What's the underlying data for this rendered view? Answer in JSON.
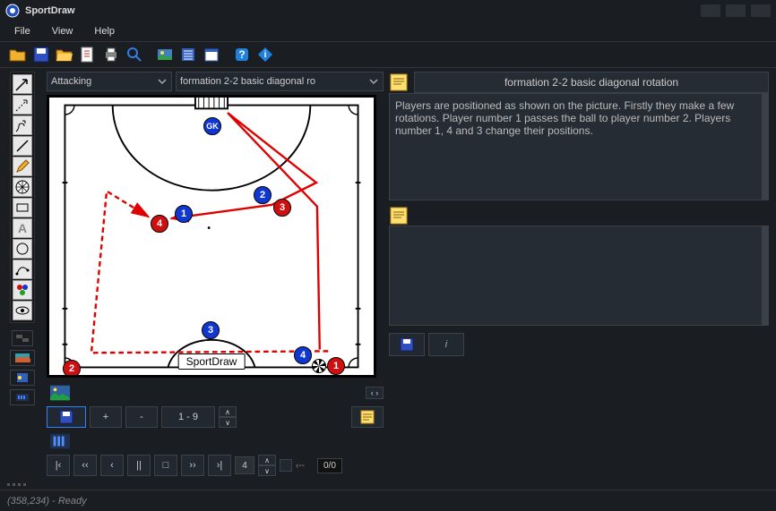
{
  "app": {
    "title": "SportDraw"
  },
  "menu": {
    "file": "File",
    "view": "View",
    "help": "Help"
  },
  "dropdowns": {
    "category": "Attacking",
    "play": "formation 2-2 basic diagonal ro"
  },
  "canvas": {
    "watermark": "SportDraw",
    "players": {
      "gk": "GK",
      "b1": "1",
      "b2": "2",
      "b3": "3",
      "b4": "4",
      "r1": "1",
      "r2": "2",
      "r3": "3",
      "r4": "4"
    }
  },
  "info": {
    "title": "formation 2-2 basic diagonal rotation",
    "body": "Players are positioned as shown on the picture. Firstly they make a few rotations. Player number 1 passes the ball to player number 2. Players number 1, 4 and 3 change their positions."
  },
  "controls": {
    "plus": "+",
    "minus": "-",
    "range": "1 - 9",
    "up": "∧",
    "down": "∨",
    "first": "|‹",
    "rew": "‹‹",
    "back": "‹",
    "pause": "||",
    "stop": "□",
    "fwd": "››",
    "end": "›|",
    "frameValue": "4",
    "arrowLeft": "‹--",
    "counter": "0/0",
    "info_btn": "i"
  },
  "status": {
    "text": "(358,234) - Ready"
  }
}
